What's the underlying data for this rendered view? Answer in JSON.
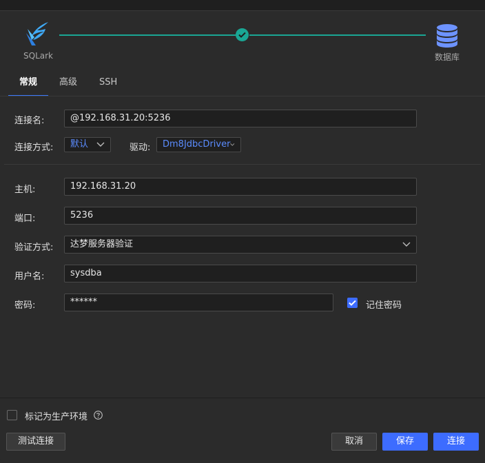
{
  "header": {
    "logo_label": "SQLark",
    "target_label": "数据库",
    "accent_color": "#1aa795"
  },
  "tabs": [
    {
      "label": "常规",
      "active": true
    },
    {
      "label": "高级",
      "active": false
    },
    {
      "label": "SSH",
      "active": false
    }
  ],
  "form": {
    "connection_name": {
      "label": "连接名:",
      "value": "@192.168.31.20:5236"
    },
    "connection_method": {
      "label": "连接方式:",
      "value": "默认"
    },
    "driver": {
      "label": "驱动:",
      "value": "Dm8JdbcDriver"
    },
    "host": {
      "label": "主机:",
      "value": "192.168.31.20"
    },
    "port": {
      "label": "端口:",
      "value": "5236"
    },
    "auth_method": {
      "label": "验证方式:",
      "value": "达梦服务器验证"
    },
    "username": {
      "label": "用户名:",
      "value": "sysdba"
    },
    "password": {
      "label": "密码:",
      "value": "******"
    },
    "remember_password": {
      "label": "记住密码",
      "checked": true
    }
  },
  "footer": {
    "mark_production": {
      "label": "标记为生产环境",
      "checked": false
    },
    "test_button": "测试连接",
    "cancel_button": "取消",
    "save_button": "保存",
    "connect_button": "连接"
  }
}
